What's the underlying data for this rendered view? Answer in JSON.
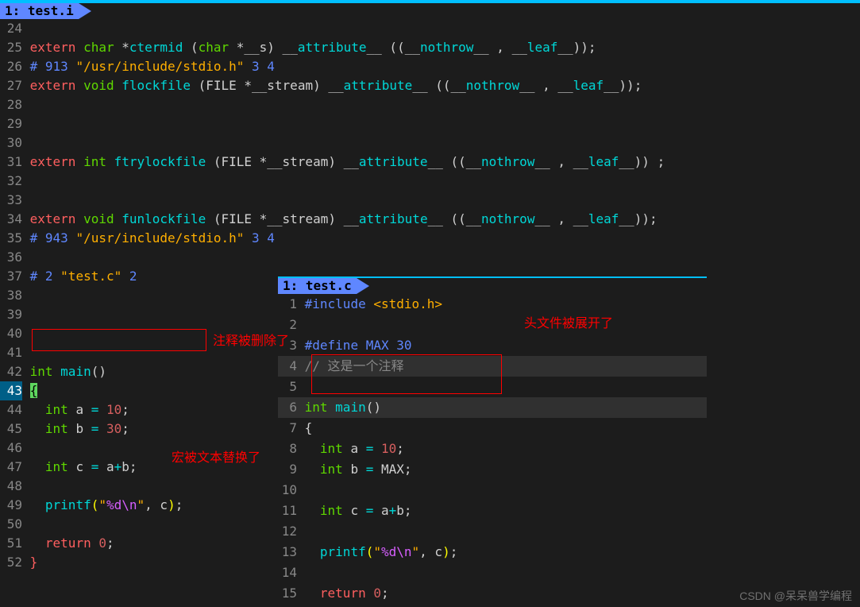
{
  "main_tab": {
    "label": " 1: test.i "
  },
  "overlay_tab": {
    "label": " 1: test.c "
  },
  "annotations": {
    "comment_deleted": "注释被删除了",
    "header_expanded": "头文件被展开了",
    "macro_replaced": "宏被文本替换了"
  },
  "watermark": "CSDN @呆呆兽学编程",
  "main_lines": [
    {
      "num": "24",
      "tokens": []
    },
    {
      "num": "25",
      "tokens": [
        [
          "kw-keyword",
          "extern "
        ],
        [
          "kw-type",
          "char "
        ],
        [
          "kw-ident",
          "*"
        ],
        [
          "kw-func",
          "ctermid"
        ],
        [
          "kw-ident",
          " ("
        ],
        [
          "kw-type",
          "char"
        ],
        [
          "kw-ident",
          " *__s) __"
        ],
        [
          "kw-func",
          "attribute"
        ],
        [
          "kw-ident",
          "__ ((__"
        ],
        [
          "kw-func",
          "nothrow"
        ],
        [
          "kw-ident",
          "__ , __"
        ],
        [
          "kw-func",
          "leaf"
        ],
        [
          "kw-ident",
          "__));"
        ]
      ]
    },
    {
      "num": "26",
      "tokens": [
        [
          "kw-pp",
          "# 913 "
        ],
        [
          "kw-string",
          "\"/usr/include/stdio.h\""
        ],
        [
          "kw-pp",
          " 3 4"
        ]
      ]
    },
    {
      "num": "27",
      "tokens": [
        [
          "kw-keyword",
          "extern "
        ],
        [
          "kw-type",
          "void "
        ],
        [
          "kw-func",
          "flockfile"
        ],
        [
          "kw-ident",
          " (FILE *__stream) __"
        ],
        [
          "kw-func",
          "attribute"
        ],
        [
          "kw-ident",
          "__ ((__"
        ],
        [
          "kw-func",
          "nothrow"
        ],
        [
          "kw-ident",
          "__ , __"
        ],
        [
          "kw-func",
          "leaf"
        ],
        [
          "kw-ident",
          "__));"
        ]
      ]
    },
    {
      "num": "28",
      "tokens": []
    },
    {
      "num": "29",
      "tokens": []
    },
    {
      "num": "30",
      "tokens": []
    },
    {
      "num": "31",
      "tokens": [
        [
          "kw-keyword",
          "extern "
        ],
        [
          "kw-type",
          "int "
        ],
        [
          "kw-func",
          "ftrylockfile"
        ],
        [
          "kw-ident",
          " (FILE *__stream) __"
        ],
        [
          "kw-func",
          "attribute"
        ],
        [
          "kw-ident",
          "__ ((__"
        ],
        [
          "kw-func",
          "nothrow"
        ],
        [
          "kw-ident",
          "__ , __"
        ],
        [
          "kw-func",
          "leaf"
        ],
        [
          "kw-ident",
          "__)) ;"
        ]
      ]
    },
    {
      "num": "32",
      "tokens": []
    },
    {
      "num": "33",
      "tokens": []
    },
    {
      "num": "34",
      "tokens": [
        [
          "kw-keyword",
          "extern "
        ],
        [
          "kw-type",
          "void "
        ],
        [
          "kw-func",
          "funlockfile"
        ],
        [
          "kw-ident",
          " (FILE *__stream) __"
        ],
        [
          "kw-func",
          "attribute"
        ],
        [
          "kw-ident",
          "__ ((__"
        ],
        [
          "kw-func",
          "nothrow"
        ],
        [
          "kw-ident",
          "__ , __"
        ],
        [
          "kw-func",
          "leaf"
        ],
        [
          "kw-ident",
          "__));"
        ]
      ]
    },
    {
      "num": "35",
      "tokens": [
        [
          "kw-pp",
          "# 943 "
        ],
        [
          "kw-string",
          "\"/usr/include/stdio.h\""
        ],
        [
          "kw-pp",
          " 3 4"
        ]
      ]
    },
    {
      "num": "36",
      "tokens": []
    },
    {
      "num": "37",
      "tokens": [
        [
          "kw-pp",
          "# 2 "
        ],
        [
          "kw-string",
          "\"test.c\""
        ],
        [
          "kw-pp",
          " 2"
        ]
      ]
    },
    {
      "num": "38",
      "tokens": []
    },
    {
      "num": "39",
      "tokens": []
    },
    {
      "num": "40",
      "tokens": []
    },
    {
      "num": "41",
      "tokens": []
    },
    {
      "num": "42",
      "tokens": [
        [
          "kw-type",
          "int "
        ],
        [
          "kw-func",
          "main"
        ],
        [
          "kw-ident",
          "()"
        ]
      ]
    },
    {
      "num": "43",
      "current": true,
      "tokens": [
        [
          "hl-cursor",
          "{"
        ]
      ]
    },
    {
      "num": "44",
      "tokens": [
        [
          "kw-ident",
          "  "
        ],
        [
          "kw-type",
          "int "
        ],
        [
          "kw-ident",
          "a "
        ],
        [
          "kw-op",
          "="
        ],
        [
          "kw-ident",
          " "
        ],
        [
          "kw-number",
          "10"
        ],
        [
          "kw-ident",
          ";"
        ]
      ]
    },
    {
      "num": "45",
      "tokens": [
        [
          "kw-ident",
          "  "
        ],
        [
          "kw-type",
          "int "
        ],
        [
          "kw-ident",
          "b "
        ],
        [
          "kw-op",
          "="
        ],
        [
          "kw-ident",
          " "
        ],
        [
          "kw-number",
          "30"
        ],
        [
          "kw-ident",
          ";"
        ]
      ]
    },
    {
      "num": "46",
      "tokens": []
    },
    {
      "num": "47",
      "tokens": [
        [
          "kw-ident",
          "  "
        ],
        [
          "kw-type",
          "int "
        ],
        [
          "kw-ident",
          "c "
        ],
        [
          "kw-op",
          "="
        ],
        [
          "kw-ident",
          " a"
        ],
        [
          "kw-op",
          "+"
        ],
        [
          "kw-ident",
          "b;"
        ]
      ]
    },
    {
      "num": "48",
      "tokens": []
    },
    {
      "num": "49",
      "tokens": [
        [
          "kw-ident",
          "  "
        ],
        [
          "kw-func",
          "printf"
        ],
        [
          "kw-bracket1",
          "("
        ],
        [
          "kw-string",
          "\""
        ],
        [
          "kw-esc",
          "%d\\n"
        ],
        [
          "kw-string",
          "\""
        ],
        [
          "kw-ident",
          ", c"
        ],
        [
          "kw-bracket1",
          ")"
        ],
        [
          "kw-ident",
          ";"
        ]
      ]
    },
    {
      "num": "50",
      "tokens": []
    },
    {
      "num": "51",
      "tokens": [
        [
          "kw-ident",
          "  "
        ],
        [
          "kw-keyword",
          "return "
        ],
        [
          "kw-number",
          "0"
        ],
        [
          "kw-ident",
          ";"
        ]
      ]
    },
    {
      "num": "52",
      "tokens": [
        [
          "kw-bracket2",
          "}"
        ]
      ]
    }
  ],
  "overlay_lines": [
    {
      "num": "1",
      "tokens": [
        [
          "kw-pp",
          "#include "
        ],
        [
          "kw-string",
          "<stdio.h>"
        ]
      ]
    },
    {
      "num": "2",
      "tokens": []
    },
    {
      "num": "3",
      "tokens": [
        [
          "kw-pp",
          "#define MAX 30"
        ]
      ]
    },
    {
      "num": "4",
      "hl": true,
      "tokens": [
        [
          "kw-comment",
          "// 这是一个注释"
        ]
      ]
    },
    {
      "num": "5",
      "tokens": []
    },
    {
      "num": "6",
      "hlmain": true,
      "tokens": [
        [
          "kw-type",
          "int "
        ],
        [
          "kw-func",
          "main"
        ],
        [
          "kw-ident",
          "()"
        ]
      ]
    },
    {
      "num": "7",
      "tokens": [
        [
          "kw-ident",
          "{"
        ]
      ]
    },
    {
      "num": "8",
      "tokens": [
        [
          "kw-ident",
          "  "
        ],
        [
          "kw-type",
          "int "
        ],
        [
          "kw-ident",
          "a "
        ],
        [
          "kw-op",
          "="
        ],
        [
          "kw-ident",
          " "
        ],
        [
          "kw-number",
          "10"
        ],
        [
          "kw-ident",
          ";"
        ]
      ]
    },
    {
      "num": "9",
      "tokens": [
        [
          "kw-ident",
          "  "
        ],
        [
          "kw-type",
          "int "
        ],
        [
          "kw-ident",
          "b "
        ],
        [
          "kw-op",
          "="
        ],
        [
          "kw-ident",
          " MAX;"
        ]
      ]
    },
    {
      "num": "10",
      "tokens": []
    },
    {
      "num": "11",
      "tokens": [
        [
          "kw-ident",
          "  "
        ],
        [
          "kw-type",
          "int "
        ],
        [
          "kw-ident",
          "c "
        ],
        [
          "kw-op",
          "="
        ],
        [
          "kw-ident",
          " a"
        ],
        [
          "kw-op",
          "+"
        ],
        [
          "kw-ident",
          "b;"
        ]
      ]
    },
    {
      "num": "12",
      "tokens": []
    },
    {
      "num": "13",
      "tokens": [
        [
          "kw-ident",
          "  "
        ],
        [
          "kw-func",
          "printf"
        ],
        [
          "kw-bracket1",
          "("
        ],
        [
          "kw-string",
          "\""
        ],
        [
          "kw-esc",
          "%d\\n"
        ],
        [
          "kw-string",
          "\""
        ],
        [
          "kw-ident",
          ", c"
        ],
        [
          "kw-bracket1",
          ")"
        ],
        [
          "kw-ident",
          ";"
        ]
      ]
    },
    {
      "num": "14",
      "tokens": []
    },
    {
      "num": "15",
      "tokens": [
        [
          "kw-ident",
          "  "
        ],
        [
          "kw-keyword",
          "return "
        ],
        [
          "kw-number",
          "0"
        ],
        [
          "kw-ident",
          ";"
        ]
      ]
    }
  ]
}
